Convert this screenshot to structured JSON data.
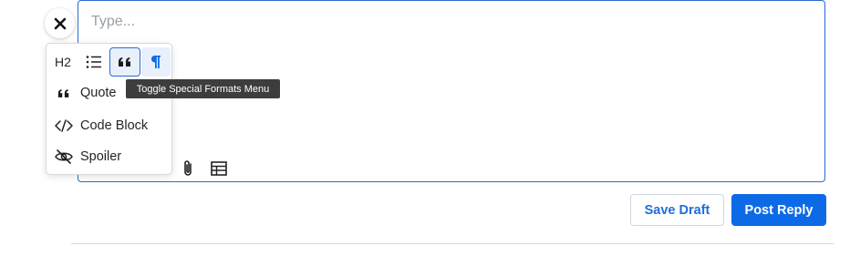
{
  "editor": {
    "placeholder": "Type..."
  },
  "format_toolbar": {
    "h2_label": "H2",
    "tooltip": "Toggle Special Formats Menu"
  },
  "special_formats_menu": {
    "items": [
      {
        "label": "Quote",
        "icon": "quote-icon"
      },
      {
        "label": "Code Block",
        "icon": "code-icon"
      },
      {
        "label": "Spoiler",
        "icon": "eye-slash-icon"
      }
    ]
  },
  "actions": {
    "save_draft": "Save Draft",
    "post_reply": "Post Reply"
  },
  "colors": {
    "accent": "#0d6ae6",
    "editor_border": "#2a6bd4",
    "tooltip_bg": "#3d3d3d"
  }
}
